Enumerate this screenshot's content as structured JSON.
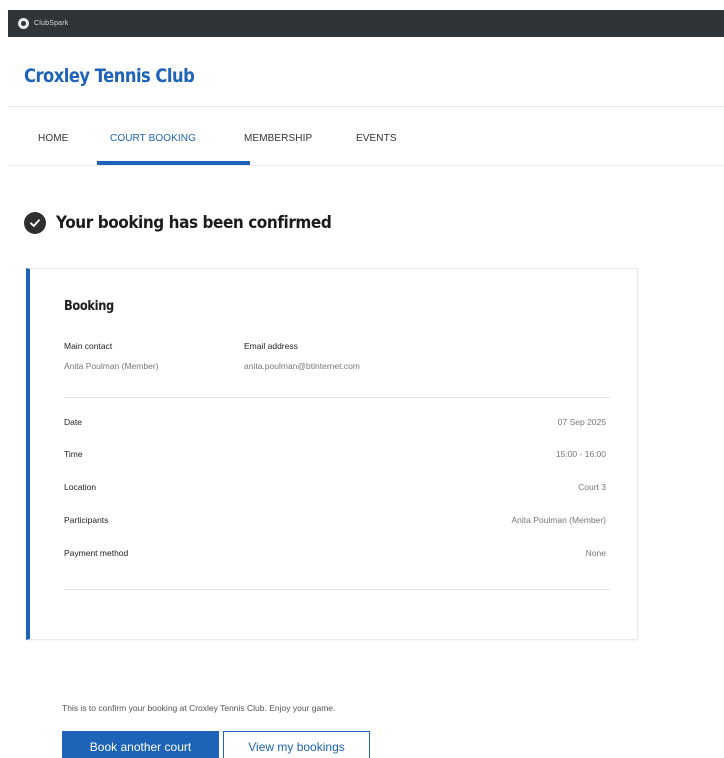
{
  "topbar": {
    "brand": "ClubSpark"
  },
  "header": {
    "club_name": "Croxley Tennis Club"
  },
  "nav": {
    "items": [
      {
        "label": "HOME"
      },
      {
        "label": "COURT BOOKING",
        "active": true
      },
      {
        "label": "MEMBERSHIP"
      },
      {
        "label": "EVENTS"
      }
    ]
  },
  "confirmation": {
    "title": "Your booking has been confirmed",
    "icon": "check-circle-icon"
  },
  "booking": {
    "heading": "Booking",
    "main_contact_label": "Main contact",
    "main_contact_value": "Anita Poulman (Member)",
    "email_label": "Email address",
    "email_value": "anita.poulman@btinternet.com",
    "details": [
      {
        "label": "Date",
        "value": "07 Sep 2025"
      },
      {
        "label": "Time",
        "value": "15:00 - 16:00"
      },
      {
        "label": "Location",
        "value": "Court 3"
      },
      {
        "label": "Participants",
        "value": "Anita Poulman (Member)"
      },
      {
        "label": "Payment method",
        "value": "None"
      }
    ]
  },
  "footer": {
    "message": "This is to confirm your booking at Croxley Tennis Club. Enjoy your game.",
    "primary_button": "Book another court",
    "secondary_button": "View my bookings"
  },
  "colors": {
    "accent": "#1d63b8",
    "topbar": "#2f3438"
  }
}
